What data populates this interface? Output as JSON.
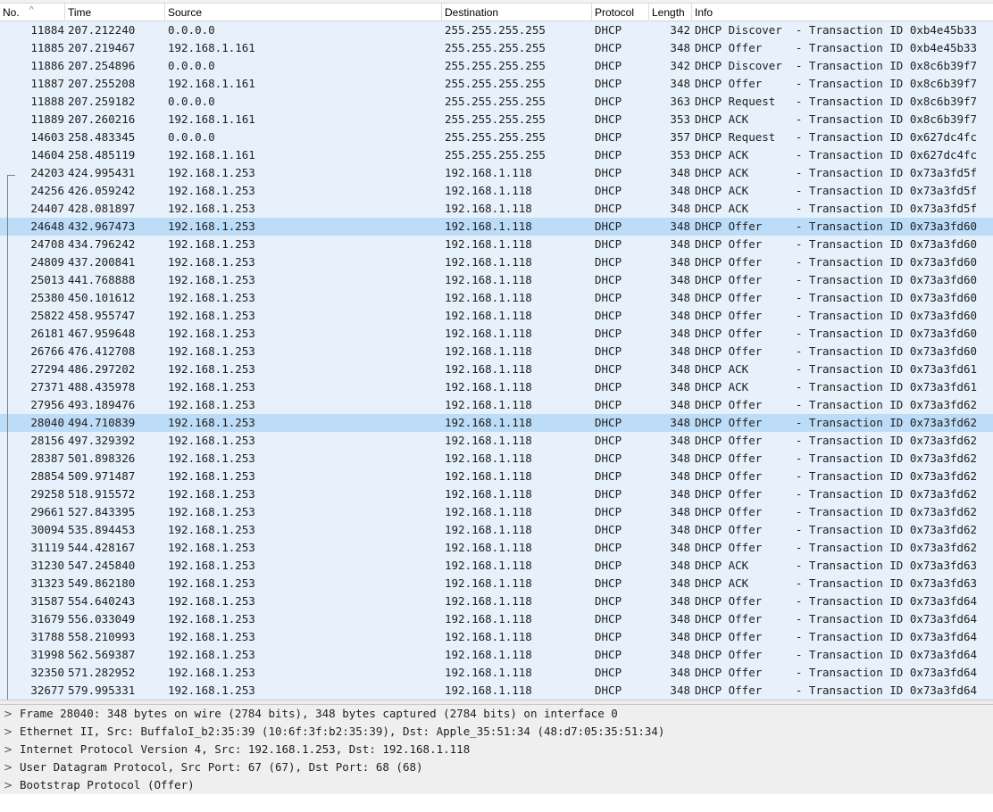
{
  "columns": {
    "no": "No.",
    "time": "Time",
    "source": "Source",
    "destination": "Destination",
    "protocol": "Protocol",
    "length": "Length",
    "info": "Info"
  },
  "sort_indicator": "^",
  "colors": {
    "row_bg": "#e7f1fc",
    "row_highlight": "#bddcf8",
    "details_bg": "#efefef"
  },
  "packets": [
    {
      "no": "11884",
      "time": "207.212240",
      "src": "0.0.0.0",
      "dst": "255.255.255.255",
      "proto": "DHCP",
      "len": "342",
      "info": "DHCP Discover  - Transaction ID 0xb4e45b33"
    },
    {
      "no": "11885",
      "time": "207.219467",
      "src": "192.168.1.161",
      "dst": "255.255.255.255",
      "proto": "DHCP",
      "len": "348",
      "info": "DHCP Offer     - Transaction ID 0xb4e45b33"
    },
    {
      "no": "11886",
      "time": "207.254896",
      "src": "0.0.0.0",
      "dst": "255.255.255.255",
      "proto": "DHCP",
      "len": "342",
      "info": "DHCP Discover  - Transaction ID 0x8c6b39f7"
    },
    {
      "no": "11887",
      "time": "207.255208",
      "src": "192.168.1.161",
      "dst": "255.255.255.255",
      "proto": "DHCP",
      "len": "348",
      "info": "DHCP Offer     - Transaction ID 0x8c6b39f7"
    },
    {
      "no": "11888",
      "time": "207.259182",
      "src": "0.0.0.0",
      "dst": "255.255.255.255",
      "proto": "DHCP",
      "len": "363",
      "info": "DHCP Request   - Transaction ID 0x8c6b39f7"
    },
    {
      "no": "11889",
      "time": "207.260216",
      "src": "192.168.1.161",
      "dst": "255.255.255.255",
      "proto": "DHCP",
      "len": "353",
      "info": "DHCP ACK       - Transaction ID 0x8c6b39f7"
    },
    {
      "no": "14603",
      "time": "258.483345",
      "src": "0.0.0.0",
      "dst": "255.255.255.255",
      "proto": "DHCP",
      "len": "357",
      "info": "DHCP Request   - Transaction ID 0x627dc4fc"
    },
    {
      "no": "14604",
      "time": "258.485119",
      "src": "192.168.1.161",
      "dst": "255.255.255.255",
      "proto": "DHCP",
      "len": "353",
      "info": "DHCP ACK       - Transaction ID 0x627dc4fc"
    },
    {
      "no": "24203",
      "time": "424.995431",
      "src": "192.168.1.253",
      "dst": "192.168.1.118",
      "proto": "DHCP",
      "len": "348",
      "info": "DHCP ACK       - Transaction ID 0x73a3fd5f"
    },
    {
      "no": "24256",
      "time": "426.059242",
      "src": "192.168.1.253",
      "dst": "192.168.1.118",
      "proto": "DHCP",
      "len": "348",
      "info": "DHCP ACK       - Transaction ID 0x73a3fd5f"
    },
    {
      "no": "24407",
      "time": "428.081897",
      "src": "192.168.1.253",
      "dst": "192.168.1.118",
      "proto": "DHCP",
      "len": "348",
      "info": "DHCP ACK       - Transaction ID 0x73a3fd5f"
    },
    {
      "no": "24648",
      "time": "432.967473",
      "src": "192.168.1.253",
      "dst": "192.168.1.118",
      "proto": "DHCP",
      "len": "348",
      "info": "DHCP Offer     - Transaction ID 0x73a3fd60",
      "hl": true
    },
    {
      "no": "24708",
      "time": "434.796242",
      "src": "192.168.1.253",
      "dst": "192.168.1.118",
      "proto": "DHCP",
      "len": "348",
      "info": "DHCP Offer     - Transaction ID 0x73a3fd60"
    },
    {
      "no": "24809",
      "time": "437.200841",
      "src": "192.168.1.253",
      "dst": "192.168.1.118",
      "proto": "DHCP",
      "len": "348",
      "info": "DHCP Offer     - Transaction ID 0x73a3fd60"
    },
    {
      "no": "25013",
      "time": "441.768888",
      "src": "192.168.1.253",
      "dst": "192.168.1.118",
      "proto": "DHCP",
      "len": "348",
      "info": "DHCP Offer     - Transaction ID 0x73a3fd60"
    },
    {
      "no": "25380",
      "time": "450.101612",
      "src": "192.168.1.253",
      "dst": "192.168.1.118",
      "proto": "DHCP",
      "len": "348",
      "info": "DHCP Offer     - Transaction ID 0x73a3fd60"
    },
    {
      "no": "25822",
      "time": "458.955747",
      "src": "192.168.1.253",
      "dst": "192.168.1.118",
      "proto": "DHCP",
      "len": "348",
      "info": "DHCP Offer     - Transaction ID 0x73a3fd60"
    },
    {
      "no": "26181",
      "time": "467.959648",
      "src": "192.168.1.253",
      "dst": "192.168.1.118",
      "proto": "DHCP",
      "len": "348",
      "info": "DHCP Offer     - Transaction ID 0x73a3fd60"
    },
    {
      "no": "26766",
      "time": "476.412708",
      "src": "192.168.1.253",
      "dst": "192.168.1.118",
      "proto": "DHCP",
      "len": "348",
      "info": "DHCP Offer     - Transaction ID 0x73a3fd60"
    },
    {
      "no": "27294",
      "time": "486.297202",
      "src": "192.168.1.253",
      "dst": "192.168.1.118",
      "proto": "DHCP",
      "len": "348",
      "info": "DHCP ACK       - Transaction ID 0x73a3fd61"
    },
    {
      "no": "27371",
      "time": "488.435978",
      "src": "192.168.1.253",
      "dst": "192.168.1.118",
      "proto": "DHCP",
      "len": "348",
      "info": "DHCP ACK       - Transaction ID 0x73a3fd61"
    },
    {
      "no": "27956",
      "time": "493.189476",
      "src": "192.168.1.253",
      "dst": "192.168.1.118",
      "proto": "DHCP",
      "len": "348",
      "info": "DHCP Offer     - Transaction ID 0x73a3fd62"
    },
    {
      "no": "28040",
      "time": "494.710839",
      "src": "192.168.1.253",
      "dst": "192.168.1.118",
      "proto": "DHCP",
      "len": "348",
      "info": "DHCP Offer     - Transaction ID 0x73a3fd62",
      "hl": true
    },
    {
      "no": "28156",
      "time": "497.329392",
      "src": "192.168.1.253",
      "dst": "192.168.1.118",
      "proto": "DHCP",
      "len": "348",
      "info": "DHCP Offer     - Transaction ID 0x73a3fd62"
    },
    {
      "no": "28387",
      "time": "501.898326",
      "src": "192.168.1.253",
      "dst": "192.168.1.118",
      "proto": "DHCP",
      "len": "348",
      "info": "DHCP Offer     - Transaction ID 0x73a3fd62"
    },
    {
      "no": "28854",
      "time": "509.971487",
      "src": "192.168.1.253",
      "dst": "192.168.1.118",
      "proto": "DHCP",
      "len": "348",
      "info": "DHCP Offer     - Transaction ID 0x73a3fd62"
    },
    {
      "no": "29258",
      "time": "518.915572",
      "src": "192.168.1.253",
      "dst": "192.168.1.118",
      "proto": "DHCP",
      "len": "348",
      "info": "DHCP Offer     - Transaction ID 0x73a3fd62"
    },
    {
      "no": "29661",
      "time": "527.843395",
      "src": "192.168.1.253",
      "dst": "192.168.1.118",
      "proto": "DHCP",
      "len": "348",
      "info": "DHCP Offer     - Transaction ID 0x73a3fd62"
    },
    {
      "no": "30094",
      "time": "535.894453",
      "src": "192.168.1.253",
      "dst": "192.168.1.118",
      "proto": "DHCP",
      "len": "348",
      "info": "DHCP Offer     - Transaction ID 0x73a3fd62"
    },
    {
      "no": "31119",
      "time": "544.428167",
      "src": "192.168.1.253",
      "dst": "192.168.1.118",
      "proto": "DHCP",
      "len": "348",
      "info": "DHCP Offer     - Transaction ID 0x73a3fd62"
    },
    {
      "no": "31230",
      "time": "547.245840",
      "src": "192.168.1.253",
      "dst": "192.168.1.118",
      "proto": "DHCP",
      "len": "348",
      "info": "DHCP ACK       - Transaction ID 0x73a3fd63"
    },
    {
      "no": "31323",
      "time": "549.862180",
      "src": "192.168.1.253",
      "dst": "192.168.1.118",
      "proto": "DHCP",
      "len": "348",
      "info": "DHCP ACK       - Transaction ID 0x73a3fd63"
    },
    {
      "no": "31587",
      "time": "554.640243",
      "src": "192.168.1.253",
      "dst": "192.168.1.118",
      "proto": "DHCP",
      "len": "348",
      "info": "DHCP Offer     - Transaction ID 0x73a3fd64"
    },
    {
      "no": "31679",
      "time": "556.033049",
      "src": "192.168.1.253",
      "dst": "192.168.1.118",
      "proto": "DHCP",
      "len": "348",
      "info": "DHCP Offer     - Transaction ID 0x73a3fd64"
    },
    {
      "no": "31788",
      "time": "558.210993",
      "src": "192.168.1.253",
      "dst": "192.168.1.118",
      "proto": "DHCP",
      "len": "348",
      "info": "DHCP Offer     - Transaction ID 0x73a3fd64"
    },
    {
      "no": "31998",
      "time": "562.569387",
      "src": "192.168.1.253",
      "dst": "192.168.1.118",
      "proto": "DHCP",
      "len": "348",
      "info": "DHCP Offer     - Transaction ID 0x73a3fd64"
    },
    {
      "no": "32350",
      "time": "571.282952",
      "src": "192.168.1.253",
      "dst": "192.168.1.118",
      "proto": "DHCP",
      "len": "348",
      "info": "DHCP Offer     - Transaction ID 0x73a3fd64"
    },
    {
      "no": "32677",
      "time": "579.995331",
      "src": "192.168.1.253",
      "dst": "192.168.1.118",
      "proto": "DHCP",
      "len": "348",
      "info": "DHCP Offer     - Transaction ID 0x73a3fd64"
    }
  ],
  "details": [
    {
      "text": "Frame 28040: 348 bytes on wire (2784 bits), 348 bytes captured (2784 bits) on interface 0"
    },
    {
      "text": "Ethernet II, Src: BuffaloI_b2:35:39 (10:6f:3f:b2:35:39), Dst: Apple_35:51:34 (48:d7:05:35:51:34)"
    },
    {
      "text": "Internet Protocol Version 4, Src: 192.168.1.253, Dst: 192.168.1.118"
    },
    {
      "text": "User Datagram Protocol, Src Port: 67 (67), Dst Port: 68 (68)"
    },
    {
      "text": "Bootstrap Protocol (Offer)"
    }
  ],
  "expand_glyph": ">"
}
